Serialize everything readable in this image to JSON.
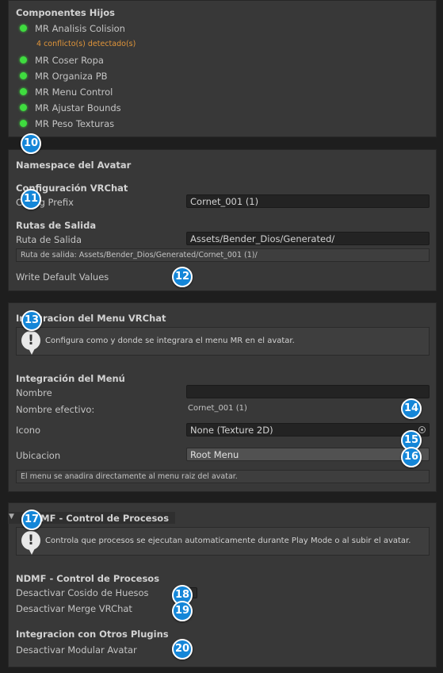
{
  "components": {
    "title": "Componentes Hijos",
    "items": [
      {
        "label": "MR Analisis Colision"
      },
      {
        "label": "MR Coser Ropa"
      },
      {
        "label": "MR Organiza PB"
      },
      {
        "label": "MR Menu Control"
      },
      {
        "label": "MR Ajustar Bounds"
      },
      {
        "label": "MR Peso Texturas"
      }
    ],
    "conflict_warning": "4 conflicto(s) detectado(s)"
  },
  "namespace": {
    "title": "Namespace del Avatar",
    "vrchat_header": "Configuración VRChat",
    "prefix_label": "Config Prefix",
    "prefix_value": "Cornet_001 (1)",
    "output_header": "Rutas de Salida",
    "output_label": "Ruta de Salida",
    "output_value": "Assets/Bender_Dios/Generated/",
    "output_info": "Ruta de salida: Assets/Bender_Dios/Generated/Cornet_001 (1)/",
    "write_defaults_label": "Write Default Values"
  },
  "menu": {
    "title": "Integracion del Menu VRChat",
    "help": "Configura como y donde se integrara el menu MR en el avatar.",
    "section_header": "Integración del Menú",
    "name_label": "Nombre",
    "name_value": "",
    "effective_label": "Nombre efectivo:",
    "effective_value": "Cornet_001 (1)",
    "icon_label": "Icono",
    "icon_value": "None (Texture 2D)",
    "location_label": "Ubicacion",
    "location_value": "Root Menu",
    "location_info": "El menu se anadira directamente al menu raiz del avatar."
  },
  "ndmf": {
    "foldout_title": "NDMF - Control de Procesos",
    "help": "Controla que procesos se ejecutan automaticamente durante Play Mode o al subir el avatar.",
    "section_header": "NDMF - Control de Procesos",
    "bones_label": "Desactivar Cosido de Huesos",
    "merge_label": "Desactivar Merge VRChat",
    "plugins_header": "Integracion con Otros Plugins",
    "modular_label": "Desactivar Modular Avatar"
  },
  "badges": [
    "10",
    "11",
    "12",
    "13",
    "14",
    "15",
    "16",
    "17",
    "18",
    "19",
    "20"
  ],
  "colors": {
    "status_ok": "#3fdc3f",
    "warning_text": "#e0953a",
    "badge": "#1486d8"
  }
}
